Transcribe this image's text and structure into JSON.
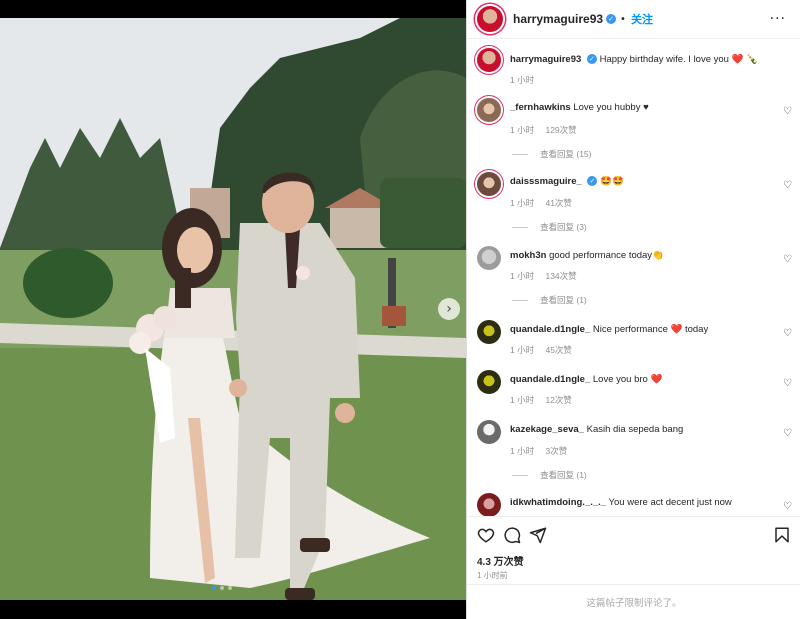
{
  "post": {
    "username": "harrymaguire93",
    "follow_label": "关注",
    "more_label": "···",
    "caption_text": "Happy birthday wife. I love you ❤️ 🍾",
    "caption_time": "1 小时",
    "photo_alt": "Wedding photo"
  },
  "comments": [
    {
      "user": "_fernhawkins",
      "text": "Love you hubby ♥",
      "time": "1 小时",
      "likes": "129次赞",
      "reply_label": "",
      "view_replies": "查看回复 (15)"
    },
    {
      "user": "daisssmaguire_",
      "verified": true,
      "text": "🤩🤩",
      "time": "1 小时",
      "likes": "41次赞",
      "view_replies": "查看回复 (3)"
    },
    {
      "user": "mokh3n",
      "text": "good performance today👏",
      "time": "1 小时",
      "likes": "134次赞",
      "view_replies": "查看回复 (1)"
    },
    {
      "user": "quandale.d1ngle_",
      "text": "Nice performance ❤️ today",
      "time": "1 小时",
      "likes": "45次赞",
      "view_replies": ""
    },
    {
      "user": "quandale.d1ngle_",
      "text": "Love you bro ❤️",
      "time": "1 小时",
      "likes": "12次赞",
      "view_replies": ""
    },
    {
      "user": "kazekage_seva_",
      "text": "Kasih dia sepeda bang",
      "time": "1 小时",
      "likes": "3次赞",
      "view_replies": "查看回复 (1)"
    },
    {
      "user": "idkwhatimdoing._._._",
      "text": "You were act decent just now",
      "time": "",
      "likes": "",
      "view_replies": ""
    }
  ],
  "footer": {
    "likes_count": "4.3 万次赞",
    "post_time": "1 小时前",
    "comments_disabled": "这篇帖子限制评论了。"
  },
  "colors": {
    "accent": "#0095f6",
    "verified": "#3897f0",
    "heart_red": "#ed4956"
  },
  "icons": {
    "like": "heart-icon",
    "comment": "comment-icon",
    "share": "share-icon",
    "save": "bookmark-icon",
    "more": "more-icon",
    "next": "chevron-right-icon"
  }
}
